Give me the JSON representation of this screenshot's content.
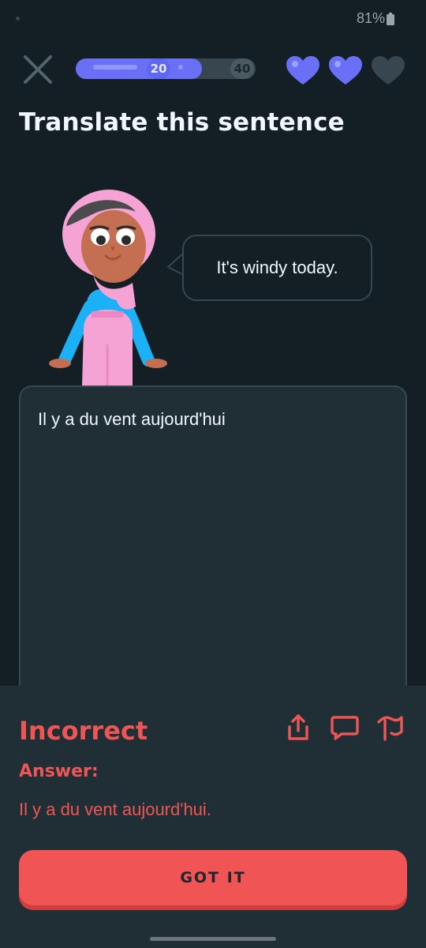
{
  "status_bar": {
    "battery_percent": "81%"
  },
  "header": {
    "close_icon": "close-icon",
    "progress": {
      "fraction": 0.7,
      "milestones": [
        "20",
        "40"
      ]
    },
    "hearts": {
      "full": 2,
      "total": 3,
      "full_color": "#6a70f6",
      "empty_color": "#37464f"
    }
  },
  "prompt": {
    "title": "Translate this sentence",
    "speech": "It's windy today."
  },
  "answer_box": {
    "user_answer": "Il y a du vent aujourd'hui"
  },
  "feedback": {
    "title": "Incorrect",
    "answer_label": "Answer:",
    "correct_answer": "Il y a du vent aujourd'hui.",
    "icons": [
      "share-icon",
      "comment-icon",
      "report-flag-icon"
    ],
    "button_label": "GOT IT",
    "accent_color": "#ee5555"
  },
  "colors": {
    "background": "#131f24",
    "panel": "#202f36",
    "border": "#37464f",
    "progress_fill": "#6a70f6"
  }
}
